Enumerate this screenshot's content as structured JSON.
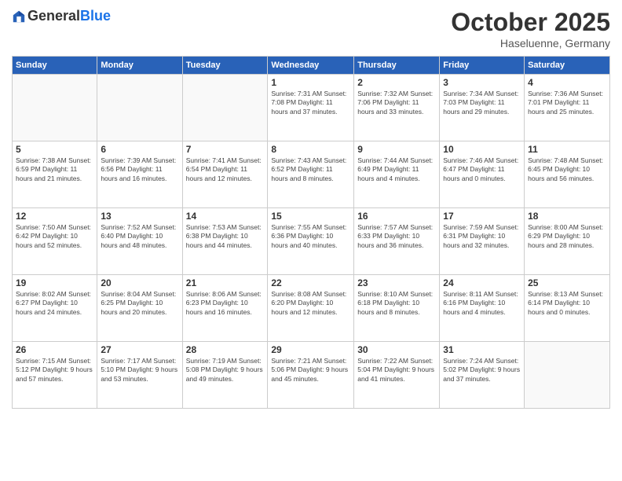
{
  "header": {
    "logo": {
      "general": "General",
      "blue": "Blue"
    },
    "month": "October 2025",
    "location": "Haseluenne, Germany"
  },
  "weekdays": [
    "Sunday",
    "Monday",
    "Tuesday",
    "Wednesday",
    "Thursday",
    "Friday",
    "Saturday"
  ],
  "weeks": [
    [
      {
        "day": "",
        "info": ""
      },
      {
        "day": "",
        "info": ""
      },
      {
        "day": "",
        "info": ""
      },
      {
        "day": "1",
        "info": "Sunrise: 7:31 AM\nSunset: 7:08 PM\nDaylight: 11 hours\nand 37 minutes."
      },
      {
        "day": "2",
        "info": "Sunrise: 7:32 AM\nSunset: 7:06 PM\nDaylight: 11 hours\nand 33 minutes."
      },
      {
        "day": "3",
        "info": "Sunrise: 7:34 AM\nSunset: 7:03 PM\nDaylight: 11 hours\nand 29 minutes."
      },
      {
        "day": "4",
        "info": "Sunrise: 7:36 AM\nSunset: 7:01 PM\nDaylight: 11 hours\nand 25 minutes."
      }
    ],
    [
      {
        "day": "5",
        "info": "Sunrise: 7:38 AM\nSunset: 6:59 PM\nDaylight: 11 hours\nand 21 minutes."
      },
      {
        "day": "6",
        "info": "Sunrise: 7:39 AM\nSunset: 6:56 PM\nDaylight: 11 hours\nand 16 minutes."
      },
      {
        "day": "7",
        "info": "Sunrise: 7:41 AM\nSunset: 6:54 PM\nDaylight: 11 hours\nand 12 minutes."
      },
      {
        "day": "8",
        "info": "Sunrise: 7:43 AM\nSunset: 6:52 PM\nDaylight: 11 hours\nand 8 minutes."
      },
      {
        "day": "9",
        "info": "Sunrise: 7:44 AM\nSunset: 6:49 PM\nDaylight: 11 hours\nand 4 minutes."
      },
      {
        "day": "10",
        "info": "Sunrise: 7:46 AM\nSunset: 6:47 PM\nDaylight: 11 hours\nand 0 minutes."
      },
      {
        "day": "11",
        "info": "Sunrise: 7:48 AM\nSunset: 6:45 PM\nDaylight: 10 hours\nand 56 minutes."
      }
    ],
    [
      {
        "day": "12",
        "info": "Sunrise: 7:50 AM\nSunset: 6:42 PM\nDaylight: 10 hours\nand 52 minutes."
      },
      {
        "day": "13",
        "info": "Sunrise: 7:52 AM\nSunset: 6:40 PM\nDaylight: 10 hours\nand 48 minutes."
      },
      {
        "day": "14",
        "info": "Sunrise: 7:53 AM\nSunset: 6:38 PM\nDaylight: 10 hours\nand 44 minutes."
      },
      {
        "day": "15",
        "info": "Sunrise: 7:55 AM\nSunset: 6:36 PM\nDaylight: 10 hours\nand 40 minutes."
      },
      {
        "day": "16",
        "info": "Sunrise: 7:57 AM\nSunset: 6:33 PM\nDaylight: 10 hours\nand 36 minutes."
      },
      {
        "day": "17",
        "info": "Sunrise: 7:59 AM\nSunset: 6:31 PM\nDaylight: 10 hours\nand 32 minutes."
      },
      {
        "day": "18",
        "info": "Sunrise: 8:00 AM\nSunset: 6:29 PM\nDaylight: 10 hours\nand 28 minutes."
      }
    ],
    [
      {
        "day": "19",
        "info": "Sunrise: 8:02 AM\nSunset: 6:27 PM\nDaylight: 10 hours\nand 24 minutes."
      },
      {
        "day": "20",
        "info": "Sunrise: 8:04 AM\nSunset: 6:25 PM\nDaylight: 10 hours\nand 20 minutes."
      },
      {
        "day": "21",
        "info": "Sunrise: 8:06 AM\nSunset: 6:23 PM\nDaylight: 10 hours\nand 16 minutes."
      },
      {
        "day": "22",
        "info": "Sunrise: 8:08 AM\nSunset: 6:20 PM\nDaylight: 10 hours\nand 12 minutes."
      },
      {
        "day": "23",
        "info": "Sunrise: 8:10 AM\nSunset: 6:18 PM\nDaylight: 10 hours\nand 8 minutes."
      },
      {
        "day": "24",
        "info": "Sunrise: 8:11 AM\nSunset: 6:16 PM\nDaylight: 10 hours\nand 4 minutes."
      },
      {
        "day": "25",
        "info": "Sunrise: 8:13 AM\nSunset: 6:14 PM\nDaylight: 10 hours\nand 0 minutes."
      }
    ],
    [
      {
        "day": "26",
        "info": "Sunrise: 7:15 AM\nSunset: 5:12 PM\nDaylight: 9 hours\nand 57 minutes."
      },
      {
        "day": "27",
        "info": "Sunrise: 7:17 AM\nSunset: 5:10 PM\nDaylight: 9 hours\nand 53 minutes."
      },
      {
        "day": "28",
        "info": "Sunrise: 7:19 AM\nSunset: 5:08 PM\nDaylight: 9 hours\nand 49 minutes."
      },
      {
        "day": "29",
        "info": "Sunrise: 7:21 AM\nSunset: 5:06 PM\nDaylight: 9 hours\nand 45 minutes."
      },
      {
        "day": "30",
        "info": "Sunrise: 7:22 AM\nSunset: 5:04 PM\nDaylight: 9 hours\nand 41 minutes."
      },
      {
        "day": "31",
        "info": "Sunrise: 7:24 AM\nSunset: 5:02 PM\nDaylight: 9 hours\nand 37 minutes."
      },
      {
        "day": "",
        "info": ""
      }
    ]
  ]
}
